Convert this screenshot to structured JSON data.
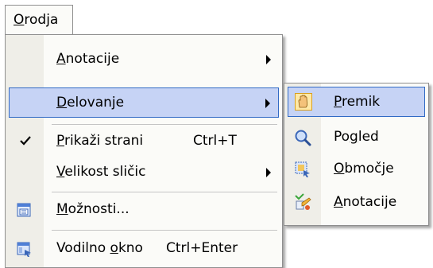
{
  "menubar": {
    "title_underlined": "O",
    "title_rest": "rodja"
  },
  "menu": {
    "items": [
      {
        "u": "A",
        "rest": "notacije",
        "shortcut": "",
        "submenu": true
      },
      {
        "u": "D",
        "rest": "elovanje",
        "shortcut": "",
        "submenu": true,
        "highlighted": true
      },
      {
        "u": "P",
        "rest": "rikaži strani",
        "shortcut": "Ctrl+T",
        "checked": true
      },
      {
        "u": "V",
        "rest": "elikost sličic",
        "shortcut": "",
        "submenu": true
      },
      {
        "pre": "",
        "u": "M",
        "rest": "ožnosti...",
        "icon": "options-icon"
      },
      {
        "pre": "Vodilno ",
        "u": "o",
        "rest": "kno",
        "shortcut": "Ctrl+Enter",
        "icon": "navigation-pane-icon"
      }
    ]
  },
  "submenu": {
    "items": [
      {
        "pre": "",
        "u": "P",
        "rest": "remik",
        "icon": "hand-icon",
        "highlighted": true
      },
      {
        "pre": "Po",
        "u": "g",
        "rest": "led",
        "icon": "magnifier-icon"
      },
      {
        "pre": "",
        "u": "O",
        "rest": "bmočje",
        "icon": "area-select-icon"
      },
      {
        "pre": "",
        "u": "A",
        "rest": "notacije",
        "icon": "annotation-icon"
      }
    ]
  },
  "colors": {
    "highlight_fill": "#c6d3f5",
    "highlight_border": "#316ac5",
    "gutter": "#efeee8",
    "menu_bg": "#fbfbf8"
  }
}
